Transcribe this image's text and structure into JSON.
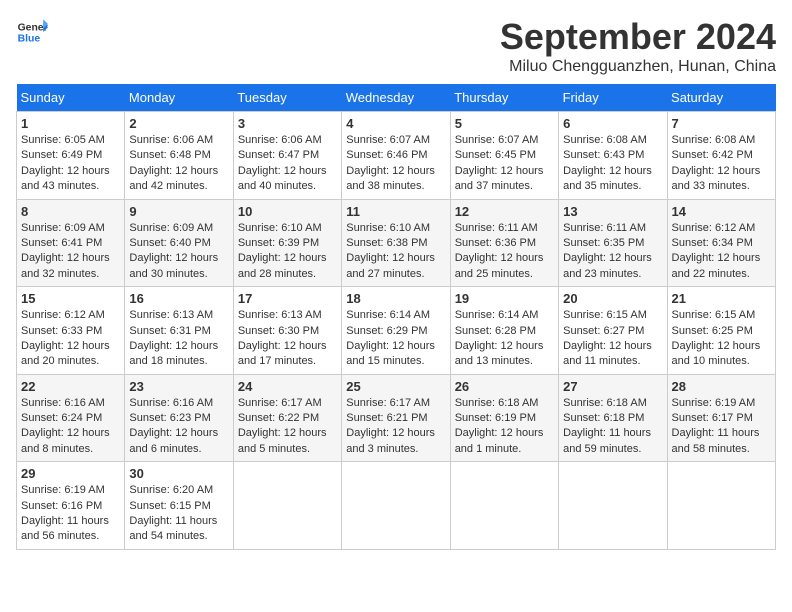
{
  "header": {
    "logo_line1": "General",
    "logo_line2": "Blue",
    "month_title": "September 2024",
    "location": "Miluo Chengguanzhen, Hunan, China"
  },
  "weekdays": [
    "Sunday",
    "Monday",
    "Tuesday",
    "Wednesday",
    "Thursday",
    "Friday",
    "Saturday"
  ],
  "weeks": [
    [
      {
        "day": "1",
        "sunrise": "6:05 AM",
        "sunset": "6:49 PM",
        "daylight": "12 hours and 43 minutes."
      },
      {
        "day": "2",
        "sunrise": "6:06 AM",
        "sunset": "6:48 PM",
        "daylight": "12 hours and 42 minutes."
      },
      {
        "day": "3",
        "sunrise": "6:06 AM",
        "sunset": "6:47 PM",
        "daylight": "12 hours and 40 minutes."
      },
      {
        "day": "4",
        "sunrise": "6:07 AM",
        "sunset": "6:46 PM",
        "daylight": "12 hours and 38 minutes."
      },
      {
        "day": "5",
        "sunrise": "6:07 AM",
        "sunset": "6:45 PM",
        "daylight": "12 hours and 37 minutes."
      },
      {
        "day": "6",
        "sunrise": "6:08 AM",
        "sunset": "6:43 PM",
        "daylight": "12 hours and 35 minutes."
      },
      {
        "day": "7",
        "sunrise": "6:08 AM",
        "sunset": "6:42 PM",
        "daylight": "12 hours and 33 minutes."
      }
    ],
    [
      {
        "day": "8",
        "sunrise": "6:09 AM",
        "sunset": "6:41 PM",
        "daylight": "12 hours and 32 minutes."
      },
      {
        "day": "9",
        "sunrise": "6:09 AM",
        "sunset": "6:40 PM",
        "daylight": "12 hours and 30 minutes."
      },
      {
        "day": "10",
        "sunrise": "6:10 AM",
        "sunset": "6:39 PM",
        "daylight": "12 hours and 28 minutes."
      },
      {
        "day": "11",
        "sunrise": "6:10 AM",
        "sunset": "6:38 PM",
        "daylight": "12 hours and 27 minutes."
      },
      {
        "day": "12",
        "sunrise": "6:11 AM",
        "sunset": "6:36 PM",
        "daylight": "12 hours and 25 minutes."
      },
      {
        "day": "13",
        "sunrise": "6:11 AM",
        "sunset": "6:35 PM",
        "daylight": "12 hours and 23 minutes."
      },
      {
        "day": "14",
        "sunrise": "6:12 AM",
        "sunset": "6:34 PM",
        "daylight": "12 hours and 22 minutes."
      }
    ],
    [
      {
        "day": "15",
        "sunrise": "6:12 AM",
        "sunset": "6:33 PM",
        "daylight": "12 hours and 20 minutes."
      },
      {
        "day": "16",
        "sunrise": "6:13 AM",
        "sunset": "6:31 PM",
        "daylight": "12 hours and 18 minutes."
      },
      {
        "day": "17",
        "sunrise": "6:13 AM",
        "sunset": "6:30 PM",
        "daylight": "12 hours and 17 minutes."
      },
      {
        "day": "18",
        "sunrise": "6:14 AM",
        "sunset": "6:29 PM",
        "daylight": "12 hours and 15 minutes."
      },
      {
        "day": "19",
        "sunrise": "6:14 AM",
        "sunset": "6:28 PM",
        "daylight": "12 hours and 13 minutes."
      },
      {
        "day": "20",
        "sunrise": "6:15 AM",
        "sunset": "6:27 PM",
        "daylight": "12 hours and 11 minutes."
      },
      {
        "day": "21",
        "sunrise": "6:15 AM",
        "sunset": "6:25 PM",
        "daylight": "12 hours and 10 minutes."
      }
    ],
    [
      {
        "day": "22",
        "sunrise": "6:16 AM",
        "sunset": "6:24 PM",
        "daylight": "12 hours and 8 minutes."
      },
      {
        "day": "23",
        "sunrise": "6:16 AM",
        "sunset": "6:23 PM",
        "daylight": "12 hours and 6 minutes."
      },
      {
        "day": "24",
        "sunrise": "6:17 AM",
        "sunset": "6:22 PM",
        "daylight": "12 hours and 5 minutes."
      },
      {
        "day": "25",
        "sunrise": "6:17 AM",
        "sunset": "6:21 PM",
        "daylight": "12 hours and 3 minutes."
      },
      {
        "day": "26",
        "sunrise": "6:18 AM",
        "sunset": "6:19 PM",
        "daylight": "12 hours and 1 minute."
      },
      {
        "day": "27",
        "sunrise": "6:18 AM",
        "sunset": "6:18 PM",
        "daylight": "11 hours and 59 minutes."
      },
      {
        "day": "28",
        "sunrise": "6:19 AM",
        "sunset": "6:17 PM",
        "daylight": "11 hours and 58 minutes."
      }
    ],
    [
      {
        "day": "29",
        "sunrise": "6:19 AM",
        "sunset": "6:16 PM",
        "daylight": "11 hours and 56 minutes."
      },
      {
        "day": "30",
        "sunrise": "6:20 AM",
        "sunset": "6:15 PM",
        "daylight": "11 hours and 54 minutes."
      },
      null,
      null,
      null,
      null,
      null
    ]
  ]
}
